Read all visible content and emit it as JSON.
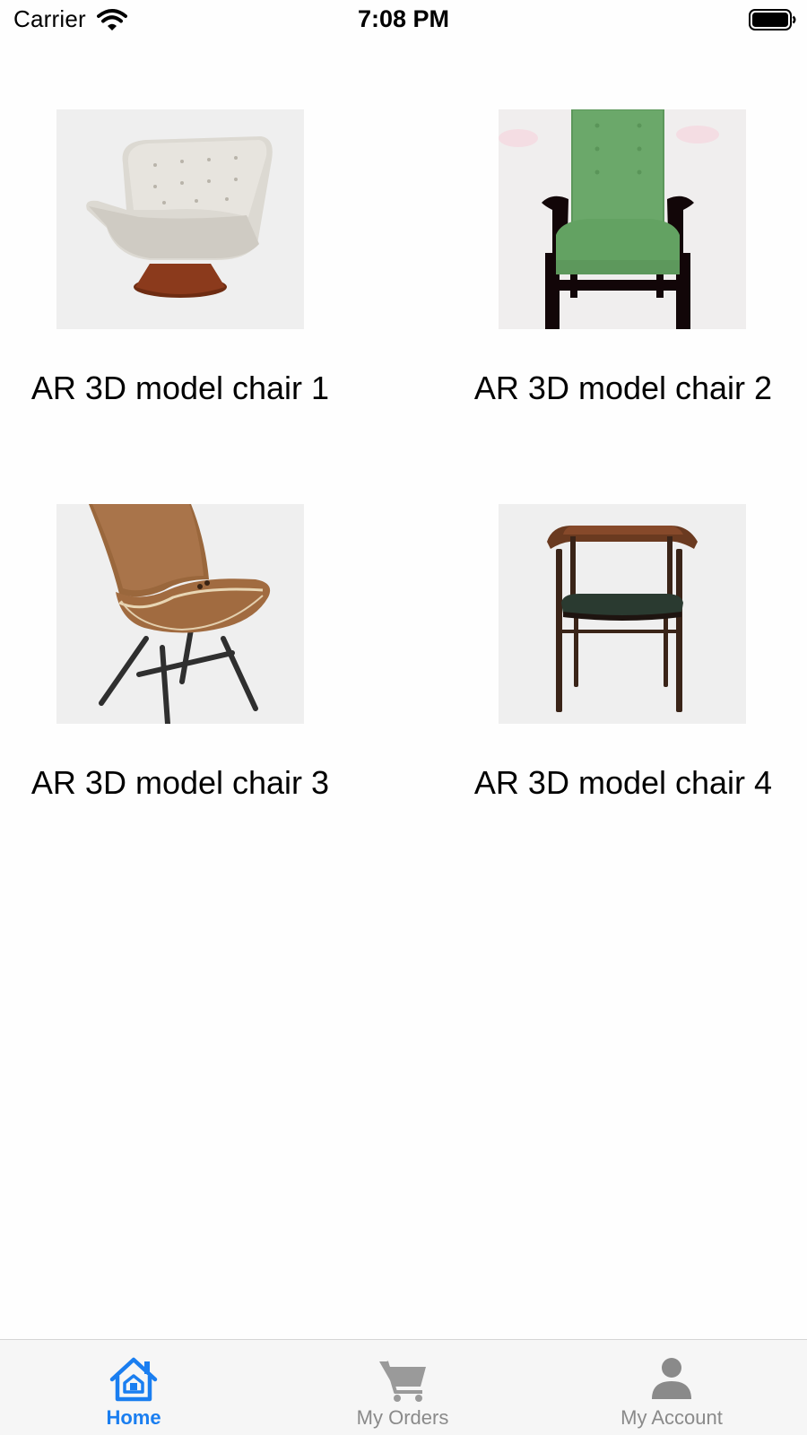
{
  "status_bar": {
    "carrier": "Carrier",
    "time": "7:08 PM",
    "icons": [
      "wifi-icon",
      "battery-icon"
    ]
  },
  "products": [
    {
      "title": "AR 3D model chair 1",
      "image": "tufted-swivel-lounge-chair"
    },
    {
      "title": "AR 3D model chair 2",
      "image": "green-upholstered-armchair"
    },
    {
      "title": "AR 3D model chair 3",
      "image": "bent-plywood-lounge-chair"
    },
    {
      "title": "AR 3D model chair 4",
      "image": "walnut-dining-armchair"
    }
  ],
  "tab_bar": {
    "active_color": "#1a7ef0",
    "inactive_color": "#8a8a8a",
    "tabs": [
      {
        "label": "Home",
        "icon": "home-icon",
        "active": true
      },
      {
        "label": "My Orders",
        "icon": "cart-icon",
        "active": false
      },
      {
        "label": "My Account",
        "icon": "person-icon",
        "active": false
      }
    ]
  }
}
